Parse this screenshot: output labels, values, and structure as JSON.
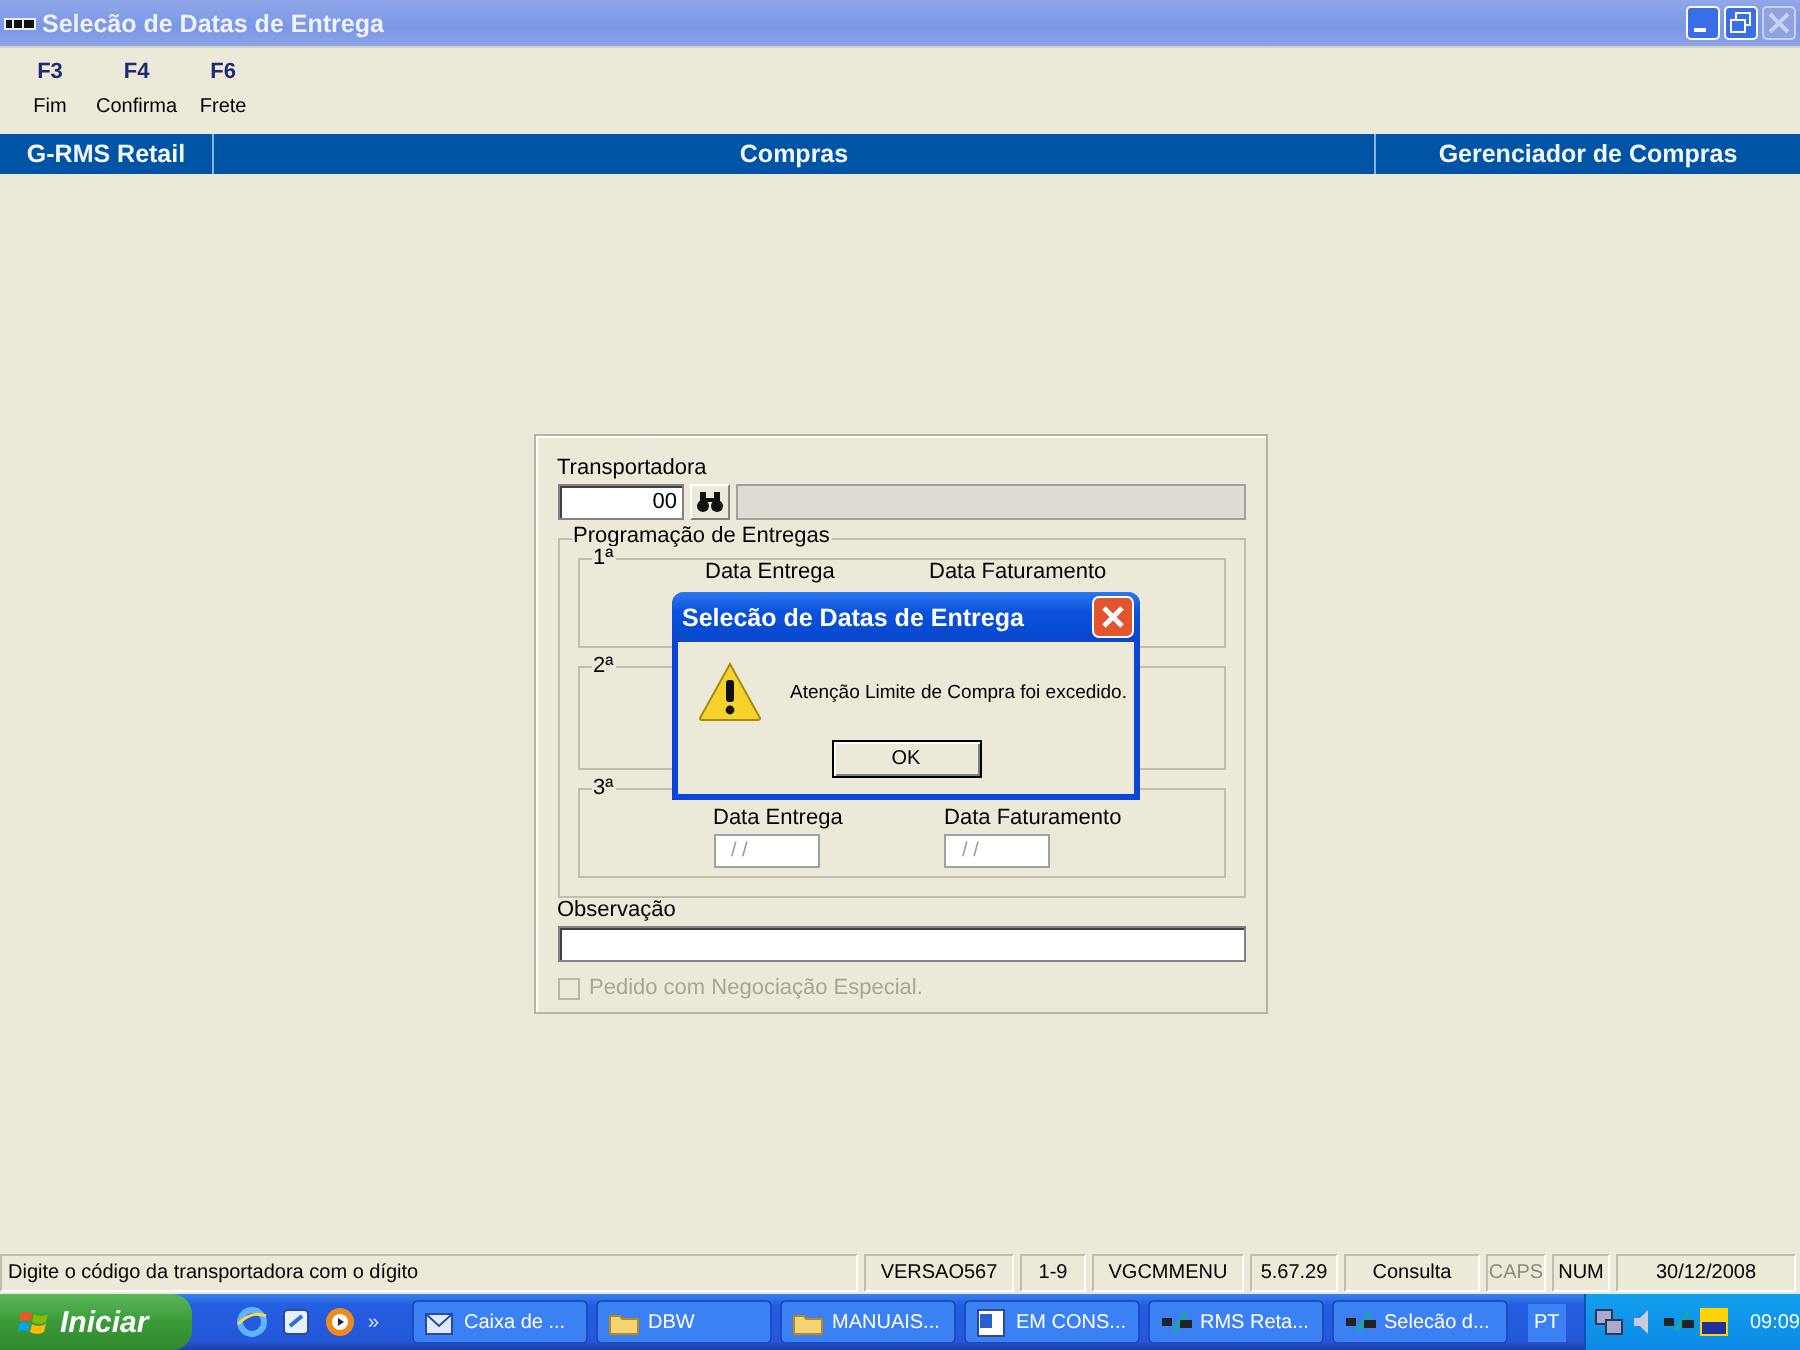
{
  "window": {
    "title": "Selecão de Datas de Entrega",
    "close_enabled": false
  },
  "toolbar": [
    {
      "key": "F3",
      "label": "Fim"
    },
    {
      "key": "F4",
      "label": "Confirma"
    },
    {
      "key": "F6",
      "label": "Frete"
    }
  ],
  "header": [
    "G-RMS Retail",
    "Compras",
    "Gerenciador de Compras"
  ],
  "form": {
    "carrier_label": "Transportadora",
    "carrier_code": "00",
    "schedule_legend": "Programação de Entregas",
    "schedules": [
      {
        "legend": "1ª",
        "delivery_label": "Data Entrega",
        "billing_label": "Data Faturamento"
      },
      {
        "legend": "2ª"
      },
      {
        "legend": "3ª",
        "delivery_label": "Data Entrega",
        "billing_label": "Data Faturamento",
        "delivery_value": "/ /",
        "billing_value": "/ /"
      }
    ],
    "observation_label": "Observação",
    "special": {
      "label": "Pedido com Negociação Especial.",
      "checked": false,
      "disabled": true
    }
  },
  "dialog": {
    "title": "Selecão de Datas de Entrega",
    "message": "Atenção Limite de Compra foi excedido.",
    "button": "OK"
  },
  "status_bar": {
    "message": "Digite o código da transportadora com o dígito",
    "cells": [
      {
        "text": "VERSAO567",
        "enabled": true
      },
      {
        "text": "1-9",
        "enabled": true
      },
      {
        "text": "VGCMMENU",
        "enabled": true
      },
      {
        "text": "5.67.29",
        "enabled": true
      },
      {
        "text": "Consulta",
        "enabled": true
      },
      {
        "text": "CAPS",
        "enabled": false
      },
      {
        "text": "NUM",
        "enabled": true
      },
      {
        "text": "30/12/2008",
        "enabled": true
      }
    ]
  },
  "taskbar": {
    "start": "Iniciar",
    "more": "»",
    "tasks": [
      {
        "label": "Caixa de ...",
        "kind": "mail"
      },
      {
        "label": "DBW",
        "kind": "folder"
      },
      {
        "label": "MANUAIS...",
        "kind": "folder"
      },
      {
        "label": "EM CONS...",
        "kind": "word"
      },
      {
        "label": "RMS Reta...",
        "kind": "rms"
      },
      {
        "label": "Selecão d...",
        "kind": "rms"
      }
    ],
    "language": "PT",
    "clock": "09:09"
  }
}
